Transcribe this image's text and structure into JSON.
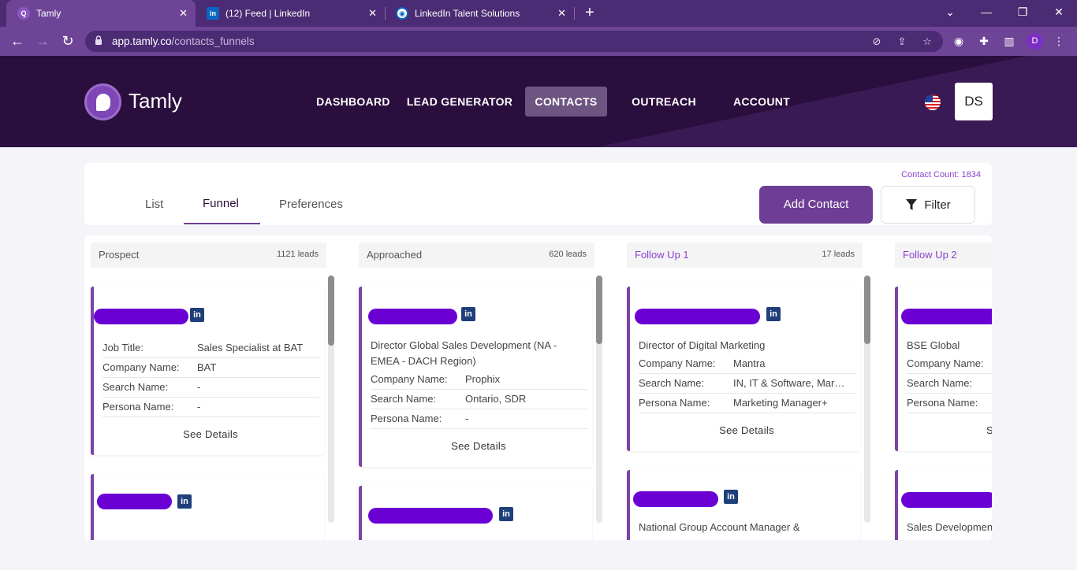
{
  "browser": {
    "tabs": [
      {
        "title": "Tamly",
        "active": true
      },
      {
        "title": "(12) Feed | LinkedIn",
        "active": false
      },
      {
        "title": "LinkedIn Talent Solutions",
        "active": false
      }
    ],
    "url_host": "app.tamly.co",
    "url_path": "/contacts_funnels",
    "profile_initial": "D"
  },
  "header": {
    "brand": "Tamly",
    "nav": [
      "DASHBOARD",
      "LEAD GENERATOR",
      "CONTACTS",
      "OUTREACH",
      "ACCOUNT"
    ],
    "active_nav": "CONTACTS",
    "user_initials": "DS"
  },
  "toolbar": {
    "contact_count": "Contact Count: 1834",
    "tabs": [
      "List",
      "Funnel",
      "Preferences"
    ],
    "active_tab": "Funnel",
    "add_contact": "Add Contact",
    "filter": "Filter"
  },
  "funnel": {
    "columns": [
      {
        "name": "Prospect",
        "count": "1121 leads"
      },
      {
        "name": "Approached",
        "count": "620 leads"
      },
      {
        "name": "Follow Up 1",
        "count": "17 leads"
      },
      {
        "name": "Follow Up 2",
        "count": ""
      }
    ],
    "labels": {
      "job_title": "Job Title:",
      "company": "Company Name:",
      "search": "Search Name:",
      "persona": "Persona Name:",
      "see_details": "See Details"
    },
    "cards": {
      "c1": {
        "job_title": "Sales Specialist at BAT",
        "company": "BAT",
        "search": "-",
        "persona": "-"
      },
      "c2": {
        "title_line1": "Director Global Sales Development (NA -",
        "title_line2": "EMEA - DACH Region)",
        "company": "Prophix",
        "search": "Ontario, SDR",
        "persona": "-"
      },
      "c3": {
        "title": "Director of Digital Marketing",
        "company": "Mantra",
        "search": "IN, IT & Software, Marketing",
        "persona": "Marketing Manager+"
      },
      "c4": {
        "title": "BSE Global",
        "see_partial": "S"
      },
      "c3b": {
        "title": "National Group Account Manager &"
      },
      "c4b": {
        "title": "Sales Development"
      }
    }
  }
}
